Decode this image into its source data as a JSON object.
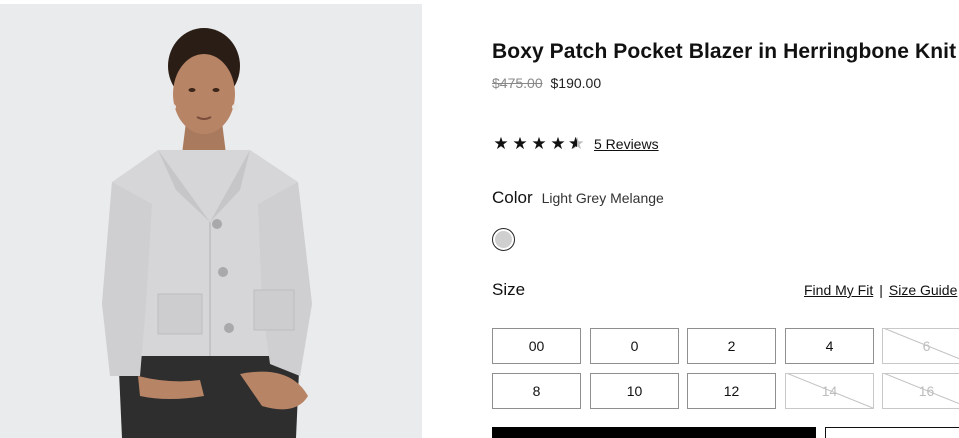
{
  "product": {
    "title": "Boxy Patch Pocket Blazer in Herringbone Knit",
    "price_original": "$475.00",
    "price_sale": "$190.00",
    "rating": 4.5,
    "reviews_label": "5 Reviews"
  },
  "color": {
    "label": "Color",
    "selected": "Light Grey Melange",
    "swatch_color": "#cfcfd0"
  },
  "size": {
    "label": "Size",
    "find_fit_label": "Find My Fit",
    "separator": "|",
    "guide_label": "Size Guide",
    "options": [
      {
        "label": "00",
        "available": true
      },
      {
        "label": "0",
        "available": true
      },
      {
        "label": "2",
        "available": true
      },
      {
        "label": "4",
        "available": true
      },
      {
        "label": "6",
        "available": false
      },
      {
        "label": "8",
        "available": true
      },
      {
        "label": "10",
        "available": true
      },
      {
        "label": "12",
        "available": true
      },
      {
        "label": "14",
        "available": false
      },
      {
        "label": "16",
        "available": false
      }
    ]
  },
  "colors": {
    "accent": "#000000",
    "border": "#8f8f8f",
    "disabled": "#bdbdbd"
  }
}
